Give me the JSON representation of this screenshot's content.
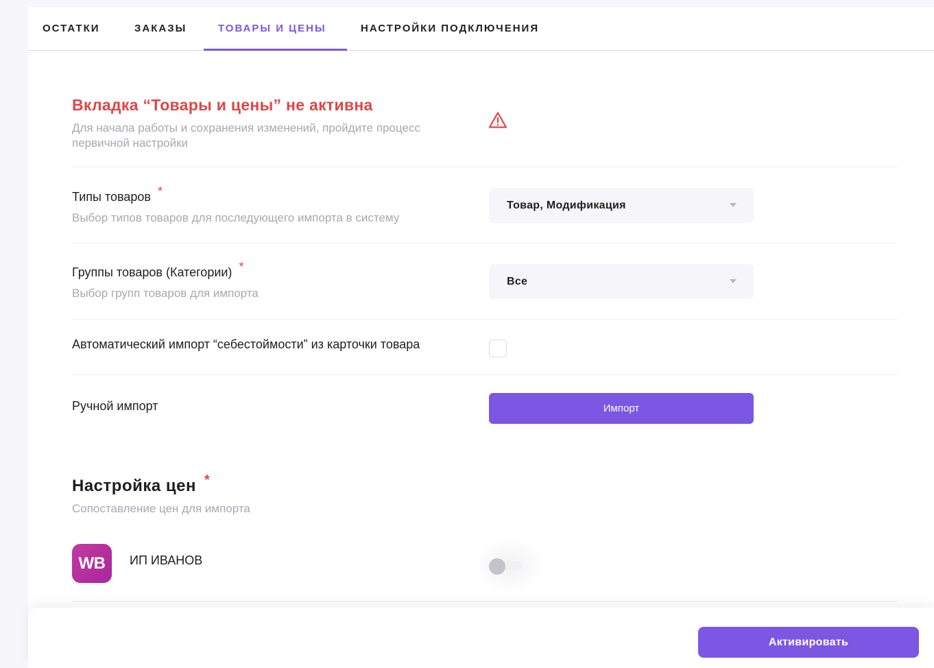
{
  "tabs": [
    {
      "label": "ОСТАТКИ",
      "active": false
    },
    {
      "label": "ЗАКАЗЫ",
      "active": false
    },
    {
      "label": "ТОВАРЫ И ЦЕНЫ",
      "active": true
    },
    {
      "label": "НАСТРОЙКИ ПОДКЛЮЧЕНИЯ",
      "active": false
    }
  ],
  "warning": {
    "title": "Вкладка “Товары и цены” не активна",
    "description": "Для начала работы и сохранения изменений, пройдите процесс первичной настройки",
    "icon": "warning-triangle-icon",
    "color": "#e04646"
  },
  "settings": {
    "product_types": {
      "label": "Типы товаров",
      "required_mark": "*",
      "hint": "Выбор типов товаров для последующего импорта в систему",
      "value": "Товар, Модификация"
    },
    "product_groups": {
      "label": "Группы товаров (Категории)",
      "required_mark": "*",
      "hint": "Выбор групп товаров для импорта",
      "value": "Все"
    },
    "auto_import_cost": {
      "label": "Автоматический импорт “себестоймости” из карточки товара",
      "checked": false
    },
    "manual_import": {
      "label": "Ручной импорт",
      "button_label": "Импорт"
    }
  },
  "price_settings": {
    "title": "Настройка цен",
    "required_mark": "*",
    "hint": "Сопоставление цен для импорта",
    "shops": [
      {
        "logo_text": "WB",
        "name": "ИП ИВАНОВ",
        "enabled": false
      }
    ]
  },
  "footer": {
    "activate_label": "Активировать"
  },
  "colors": {
    "accent": "#7b57e3",
    "error": "#e04646",
    "wb_brand": "#b52ca0"
  }
}
